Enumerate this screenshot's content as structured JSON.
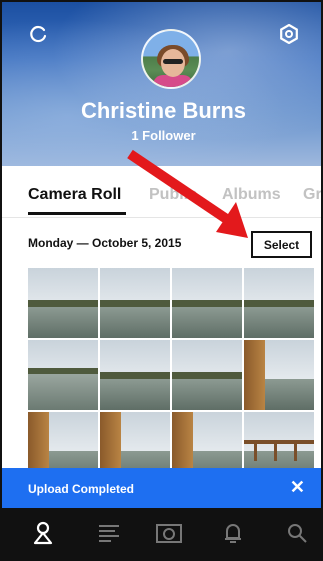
{
  "profile": {
    "name": "Christine Burns",
    "followers": "1 Follower"
  },
  "tabs": [
    {
      "label": "Camera Roll",
      "active": true
    },
    {
      "label": "Public",
      "active": false
    },
    {
      "label": "Albums",
      "active": false
    },
    {
      "label": "Gr",
      "active": false
    }
  ],
  "section": {
    "date": "Monday — October 5, 2015",
    "select_label": "Select"
  },
  "photos": [
    {
      "kind": "harbor"
    },
    {
      "kind": "harbor"
    },
    {
      "kind": "harbor"
    },
    {
      "kind": "harbor"
    },
    {
      "kind": "flood"
    },
    {
      "kind": "harbor"
    },
    {
      "kind": "harbor"
    },
    {
      "kind": "door"
    },
    {
      "kind": "door"
    },
    {
      "kind": "door"
    },
    {
      "kind": "door"
    },
    {
      "kind": "rail"
    }
  ],
  "upload": {
    "message": "Upload Completed",
    "close_glyph": "✕"
  },
  "nav": [
    {
      "icon": "profile-icon"
    },
    {
      "icon": "feed-icon"
    },
    {
      "icon": "camera-icon"
    },
    {
      "icon": "notifications-icon"
    },
    {
      "icon": "search-icon"
    }
  ],
  "colors": {
    "accent": "#1e6ff1",
    "annotation": "#e3191c",
    "nav_bg": "#111111"
  }
}
